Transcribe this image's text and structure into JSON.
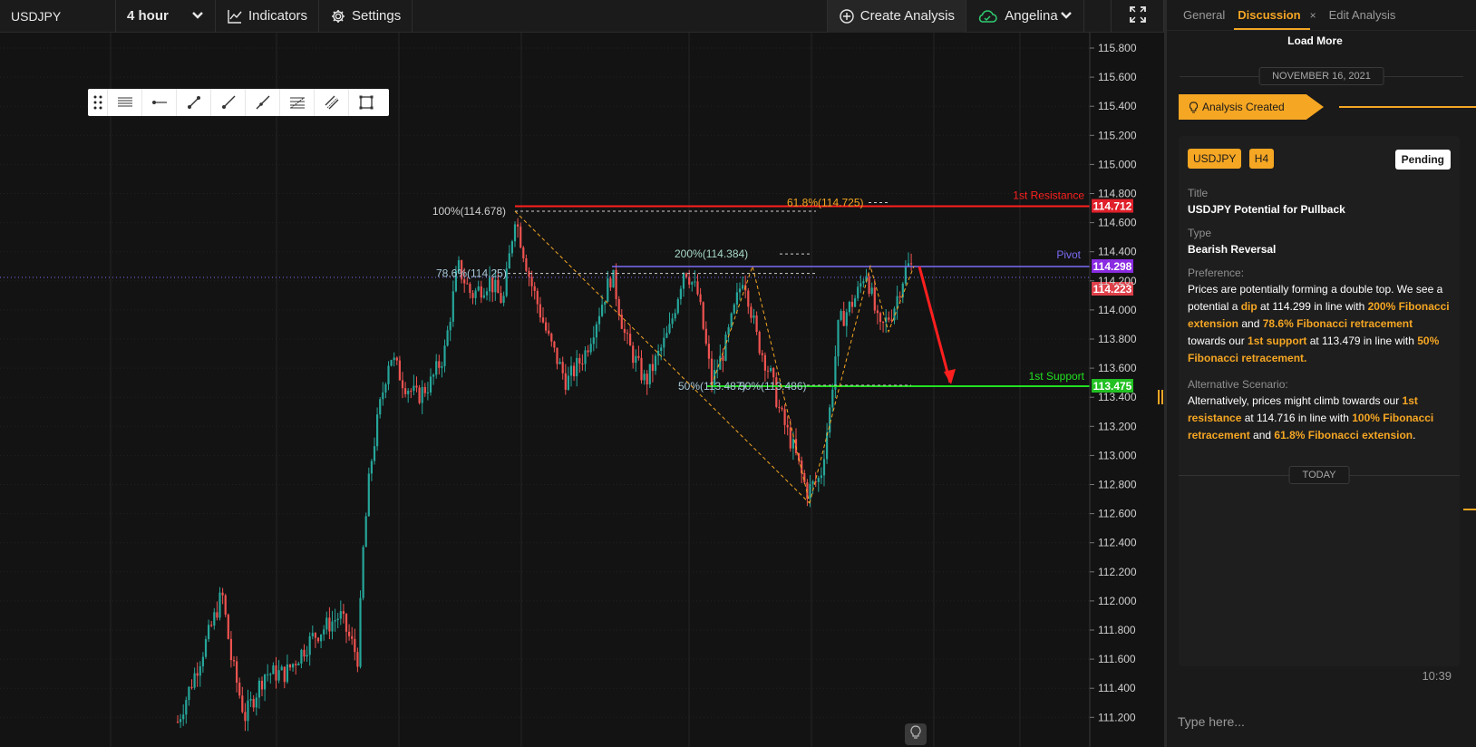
{
  "toolbar": {
    "symbol": "USDJPY",
    "interval": "4 hour",
    "indicators_label": "Indicators",
    "settings_label": "Settings",
    "create_analysis_label": "Create Analysis",
    "user_name": "Angelina"
  },
  "chart": {
    "price_axis": [
      "115.800",
      "115.600",
      "115.400",
      "115.200",
      "115.000",
      "114.800",
      "114.600",
      "114.400",
      "114.200",
      "114.000",
      "113.800",
      "113.600",
      "113.400",
      "113.200",
      "113.000",
      "112.800",
      "112.600",
      "112.400",
      "112.200",
      "112.000",
      "111.800",
      "111.600",
      "111.400",
      "111.200"
    ],
    "markers": {
      "resistance_price": "114.712",
      "pivot_price": "114.298",
      "current_price": "114.223",
      "support_price": "113.475"
    },
    "labels": {
      "resistance": "1st Resistance",
      "pivot": "Pivot",
      "support": "1st Support",
      "fib_100": "100%(114.678)",
      "fib_618": "61.8%(114.725)",
      "fib_200": "200%(114.384)",
      "fib_786": "78.6%(114.25)",
      "fib_50_a": "50%(113.487)",
      "fib_50_b": "50%(113.486)"
    },
    "colors": {
      "up": "#26a69a",
      "down": "#ef5350",
      "resistance": "#ff1f1f",
      "pivot": "#7b6cf6",
      "support": "#21e021",
      "fib": "#f5a623",
      "arrow": "#ff1f1f"
    }
  },
  "drawing_tools": [
    "drag-handle",
    "horizontal-lines-icon",
    "horizontal-ray-icon",
    "trend-line-icon",
    "ray-line-icon",
    "extended-line-icon",
    "fib-retracement-icon",
    "parallel-channel-icon",
    "rectangle-icon"
  ],
  "panel": {
    "tabs": [
      "General",
      "Discussion",
      "Edit Analysis"
    ],
    "tab_close": "×",
    "load_more": "Load More",
    "date_label": "NOVEMBER 16, 2021",
    "event_tag": "Analysis Created",
    "badges": [
      "USDJPY",
      "H4"
    ],
    "status": "Pending",
    "title_label": "Title",
    "title_value": "USDJPY Potential for Pullback",
    "type_label": "Type",
    "type_value": "Bearish Reversal",
    "preference_label": "Preference:",
    "preference": {
      "t1": "Prices are potentially forming a double top. We see a potential a ",
      "h1": "dip",
      "t2": " at 114.299 in line with ",
      "h2": "200% Fibonacci extension",
      "t3": " and ",
      "h3": "78.6% Fibonacci retracement",
      "t4": " towards our ",
      "h4": "1st support",
      "t5": " at 113.479 in line with ",
      "h5": "50% Fibonacci retracement.",
      "t6": ""
    },
    "alternative_label": "Alternative Scenario:",
    "alternative": {
      "t1": "Alternatively, prices might climb towards our ",
      "h1": "1st resistance",
      "t2": " at 114.716 in line with ",
      "h2": "100% Fibonacci retracement",
      "t3": " and ",
      "h3": "61.8% Fibonacci extension",
      "t4": "."
    },
    "today_label": "TODAY",
    "time": "10:39",
    "chat_placeholder": "Type here..."
  }
}
